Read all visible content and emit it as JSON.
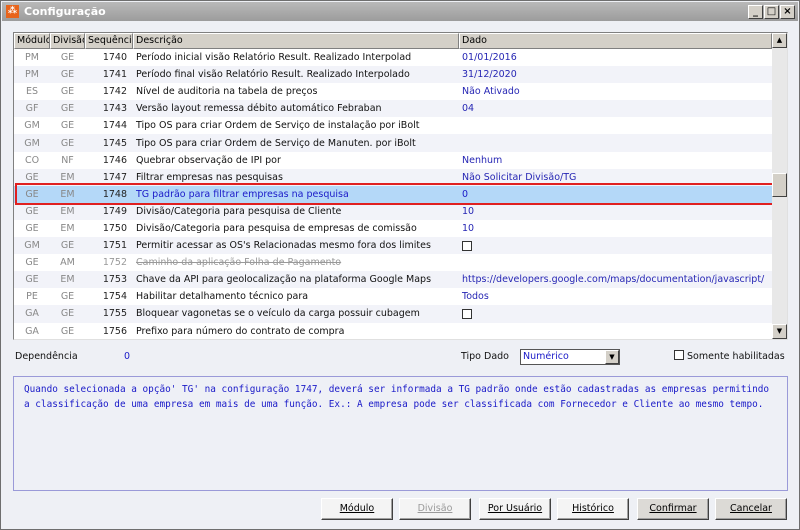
{
  "window": {
    "title": "Configuração"
  },
  "grid": {
    "columns": [
      "Módulo",
      "Divisão",
      "Sequência",
      "Descrição",
      "Dado"
    ],
    "rows": [
      {
        "modulo": "PM",
        "divisao": "GE",
        "seq": "1740",
        "desc": "Período inicial visão Relatório Result. Realizado Interpolad",
        "dado": "01/01/2016"
      },
      {
        "modulo": "PM",
        "divisao": "GE",
        "seq": "1741",
        "desc": "Período final visão Relatório Result. Realizado Interpolado",
        "dado": "31/12/2020"
      },
      {
        "modulo": "ES",
        "divisao": "GE",
        "seq": "1742",
        "desc": "Nível de auditoria na tabela de preços",
        "dado": " Não Ativado"
      },
      {
        "modulo": "GF",
        "divisao": "GE",
        "seq": "1743",
        "desc": "Versão layout remessa débito automático Febraban",
        "dado": "04"
      },
      {
        "modulo": "GM",
        "divisao": "GE",
        "seq": "1744",
        "desc": "Tipo OS para criar Ordem de Serviço de instalação por iBolt",
        "dado": ""
      },
      {
        "modulo": "GM",
        "divisao": "GE",
        "seq": "1745",
        "desc": "Tipo OS para criar Ordem de Serviço de Manuten. por iBolt",
        "dado": ""
      },
      {
        "modulo": "CO",
        "divisao": "NF",
        "seq": "1746",
        "desc": "Quebrar observação de IPI por",
        "dado": " Nenhum"
      },
      {
        "modulo": "GE",
        "divisao": "EM",
        "seq": "1747",
        "desc": "Filtrar empresas nas pesquisas",
        "dado": "Não Solicitar Divisão/TG"
      },
      {
        "modulo": "GE",
        "divisao": "EM",
        "seq": "1748",
        "desc": "TG padrão para filtrar empresas na pesquisa",
        "dado": "0",
        "selected": true
      },
      {
        "modulo": "GE",
        "divisao": "EM",
        "seq": "1749",
        "desc": "Divisão/Categoria para pesquisa de Cliente",
        "dado": "10"
      },
      {
        "modulo": "GE",
        "divisao": "EM",
        "seq": "1750",
        "desc": "Divisão/Categoria para pesquisa de empresas de comissão",
        "dado": "10"
      },
      {
        "modulo": "GM",
        "divisao": "GE",
        "seq": "1751",
        "desc": "Permitir acessar as OS's Relacionadas mesmo fora dos limites",
        "dado": "",
        "checkbox": true
      },
      {
        "modulo": "GE",
        "divisao": "AM",
        "seq": "1752",
        "desc": "Caminho da aplicação Folha de Pagamento",
        "dado": "",
        "disabled": true
      },
      {
        "modulo": "GE",
        "divisao": "EM",
        "seq": "1753",
        "desc": "Chave da API para geolocalização na plataforma Google Maps",
        "dado": "https://developers.google.com/maps/documentation/javascript/"
      },
      {
        "modulo": "PE",
        "divisao": "GE",
        "seq": "1754",
        "desc": "Habilitar detalhamento técnico para",
        "dado": "Todos"
      },
      {
        "modulo": "GA",
        "divisao": "GE",
        "seq": "1755",
        "desc": "Bloquear vagonetas se o veículo da carga possuir cubagem",
        "dado": "",
        "checkbox": true
      },
      {
        "modulo": "GA",
        "divisao": "GE",
        "seq": "1756",
        "desc": "Prefixo para número do contrato de compra",
        "dado": ""
      }
    ]
  },
  "footer": {
    "dependencia_label": "Dependência",
    "dependencia_value": "0",
    "tipo_dado_label": "Tipo Dado",
    "tipo_dado_value": "Numérico",
    "somente_label": "Somente habilitadas",
    "description": "Quando selecionada a opção' TG' na configuração 1747, deverá ser informada a TG padrão onde estão cadastradas as empresas permitindo a classificação de uma empresa em mais de uma função. Ex.: A empresa pode ser classificada com Fornecedor e Cliente ao mesmo tempo."
  },
  "buttons": {
    "modulo": "Módulo",
    "divisao": "Divisão",
    "por_usuario": "Por Usuário",
    "historico": "Histórico",
    "confirmar": "Confirmar",
    "cancelar": "Cancelar"
  }
}
